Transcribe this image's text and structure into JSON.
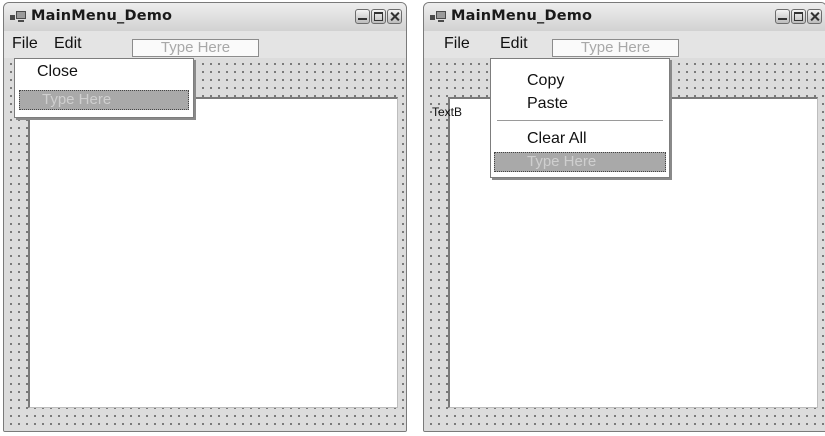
{
  "left_window": {
    "title": "MainMenu_Demo",
    "menu": {
      "file": "File",
      "edit": "Edit",
      "type_here": "Type Here"
    },
    "file_menu": {
      "items": [
        "Close"
      ],
      "type_here": "Type Here"
    }
  },
  "right_window": {
    "title": "MainMenu_Demo",
    "menu": {
      "file": "File",
      "edit": "Edit",
      "type_here": "Type Here"
    },
    "textbox_label": "TextB",
    "edit_menu": {
      "items": [
        "Copy",
        "Paste",
        "Clear All"
      ],
      "type_here": "Type Here"
    }
  },
  "colors": {
    "client_background": "#dcdcdc",
    "grid_dot": "#5e5e5e",
    "type_here_highlight": "#a9a9a9"
  },
  "icons": [
    "app-icon",
    "minimize-icon",
    "maximize-icon",
    "close-icon"
  ]
}
